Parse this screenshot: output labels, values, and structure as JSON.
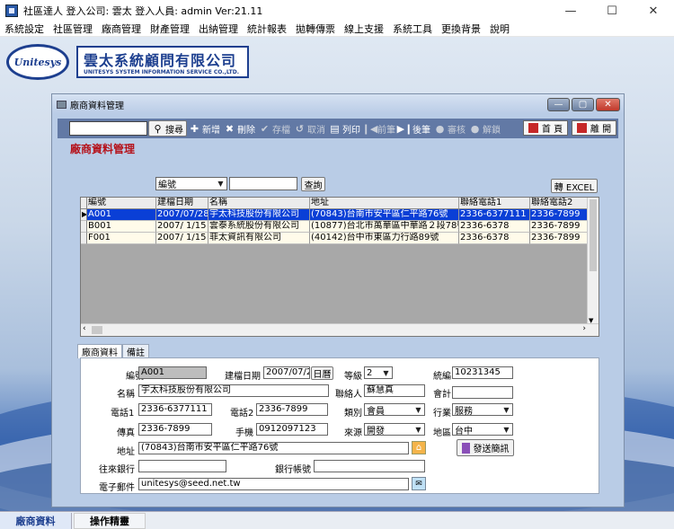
{
  "window": {
    "title": "社區達人  登入公司: 雲太  登入人員: admin Ver:21.11"
  },
  "menu": [
    "系統設定",
    "社區管理",
    "廠商管理",
    "財產管理",
    "出納管理",
    "統計報表",
    "拋轉傳票",
    "線上支援",
    "系統工具",
    "更換背景",
    "說明"
  ],
  "logo": {
    "oval_text": "Unitesys",
    "cn": "雲太系統顧問有限公司",
    "en": "UNITESYS SYSTEM INFORMATION SERVICE CO.,LTD."
  },
  "child": {
    "title": "廠商資料管理"
  },
  "toolbar": {
    "search_value": "",
    "search": "搜尋",
    "add": "新增",
    "delete": "刪除",
    "save": "存檔",
    "cancel": "取消",
    "print": "列印",
    "prev": "前筆",
    "next": "後筆",
    "audit": "審核",
    "unlock": "解鎖",
    "home": "首 頁",
    "exit": "離 開"
  },
  "filter": {
    "heading": "廠商資料管理",
    "field": "編號",
    "value": "",
    "query": "查詢",
    "excel": "轉 EXCEL"
  },
  "grid": {
    "columns": [
      "編號",
      "建檔日期",
      "名稱",
      "地址",
      "聯絡電話1",
      "聯絡電話2"
    ],
    "rows": [
      [
        "A001",
        "2007/07/28",
        "宇太科技股份有限公司",
        "(70843)台南市安平區仁平路76號",
        "2336-6377111",
        "2336-7899"
      ],
      [
        "B001",
        "2007/ 1/15",
        "雲泰系統股份有限公司",
        "(10877)台北市萬華區中華路２段78號",
        "2336-6378",
        "2336-7899"
      ],
      [
        "F001",
        "2007/ 1/15",
        "菲太資訊有限公司",
        "(40142)台中市東區力行路89號",
        "2336-6378",
        "2336-7899"
      ]
    ],
    "selected_row": 0
  },
  "tabs": [
    "廠商資料",
    "備註"
  ],
  "form": {
    "code_label": "編號",
    "code": "A001",
    "date_label": "建檔日期",
    "date": "2007/07/28",
    "calendar": "日曆",
    "grade_label": "等級",
    "grade": "2",
    "taxid_label": "統編",
    "taxid": "10231345",
    "name_label": "名稱",
    "name": "宇太科技股份有限公司",
    "contact_label": "聯絡人",
    "contact": "蘇慧真",
    "accountant_label": "會計",
    "accountant": "",
    "phone1_label": "電話1",
    "phone1": "2336-6377111",
    "phone2_label": "電話2",
    "phone2": "2336-7899",
    "category_label": "類別",
    "category": "會員",
    "industry_label": "行業",
    "industry": "服務",
    "fax_label": "傳真",
    "fax": "2336-7899",
    "mobile_label": "手機",
    "mobile": "0912097123",
    "source_label": "來源",
    "source": "開發",
    "region_label": "地區",
    "region": "台中",
    "address_label": "地址",
    "address": "(70843)台南市安平區仁平路76號",
    "sms": "發送簡訊",
    "bank_label": "往來銀行",
    "bank": "",
    "bankacct_label": "銀行帳號",
    "bankacct": "",
    "email_label": "電子郵件",
    "email": "unitesys@seed.net.tw"
  },
  "taskbar": [
    "廠商資料",
    "操作精靈"
  ]
}
